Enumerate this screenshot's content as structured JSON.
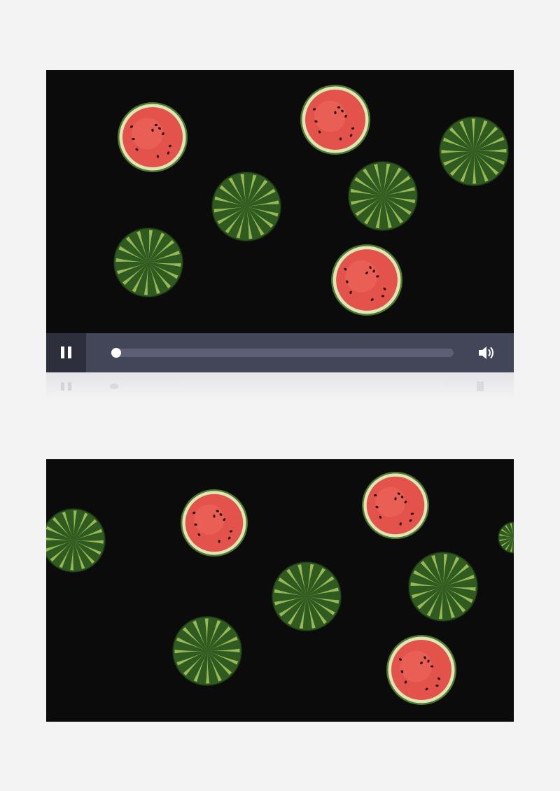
{
  "player": {
    "state": "playing",
    "progress": 0.0,
    "controls": {
      "pause_icon": "pause-icon",
      "volume_icon": "volume-icon"
    }
  },
  "colors": {
    "page_bg": "#f3f3f4",
    "video_bg": "#0b0b0c",
    "control_bar": "#434658",
    "pause_bg": "#2d2f3d",
    "rind_dark": "#2f5a20",
    "rind_light": "#a9c95e",
    "flesh": "#e4534b",
    "pith": "#dfe6b5",
    "seed": "#2a1412"
  },
  "frames": [
    {
      "id": "frame-1",
      "watermelons": [
        {
          "kind": "cut"
        },
        {
          "kind": "cut"
        },
        {
          "kind": "whole"
        },
        {
          "kind": "whole"
        },
        {
          "kind": "whole"
        },
        {
          "kind": "whole"
        },
        {
          "kind": "cut"
        }
      ]
    },
    {
      "id": "frame-2",
      "watermelons": [
        {
          "kind": "whole"
        },
        {
          "kind": "cut"
        },
        {
          "kind": "cut"
        },
        {
          "kind": "whole"
        },
        {
          "kind": "whole"
        },
        {
          "kind": "whole"
        },
        {
          "kind": "cut"
        },
        {
          "kind": "whole"
        }
      ]
    }
  ]
}
